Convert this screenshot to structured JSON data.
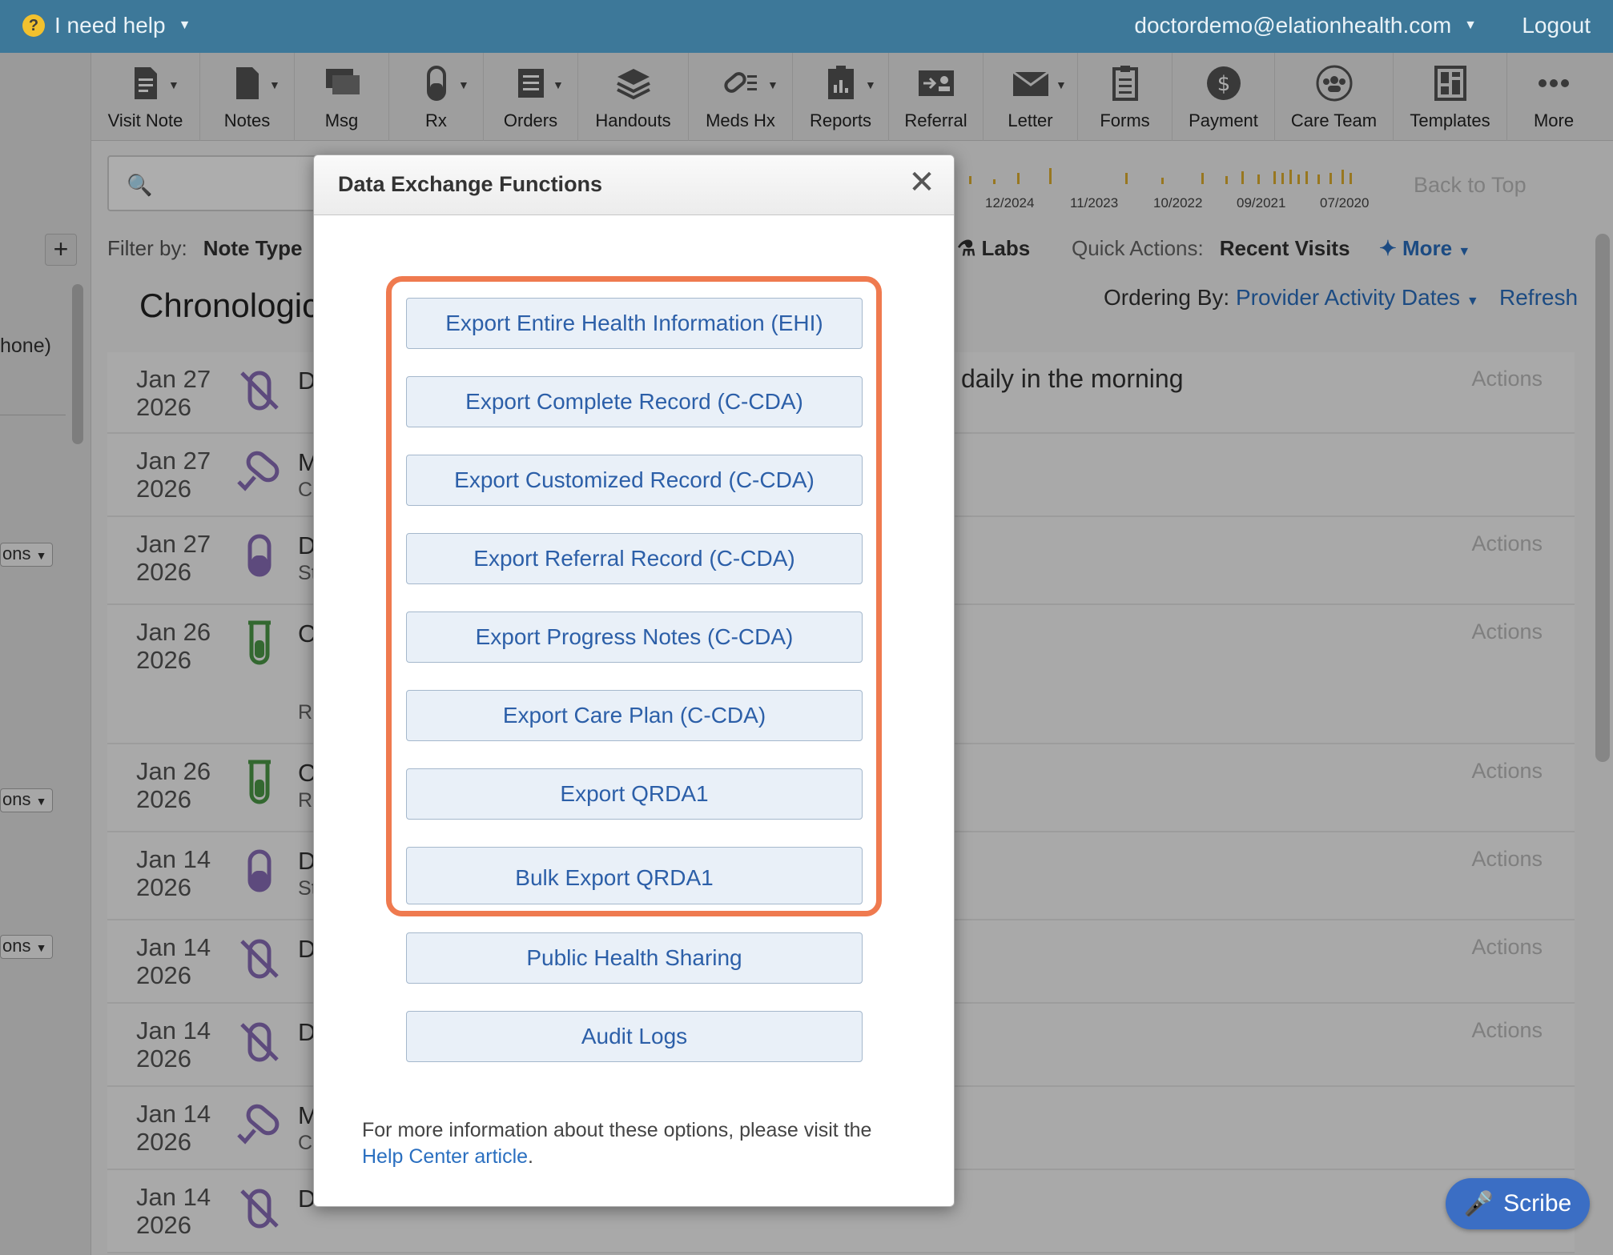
{
  "topbar": {
    "help_icon": "?",
    "help_label": "I need help",
    "user_email": "doctordemo@elationhealth.com",
    "logout": "Logout"
  },
  "toolbar": {
    "items": [
      {
        "label": "Visit Note",
        "icon": "document-icon",
        "dropdown": true
      },
      {
        "label": "Notes",
        "icon": "page-icon",
        "dropdown": true
      },
      {
        "label": "Msg",
        "icon": "chat-icon",
        "dropdown": false
      },
      {
        "label": "Rx",
        "icon": "pill-icon",
        "dropdown": true
      },
      {
        "label": "Orders",
        "icon": "list-icon",
        "dropdown": true
      },
      {
        "label": "Handouts",
        "icon": "layers-icon",
        "dropdown": false
      },
      {
        "label": "Meds Hx",
        "icon": "meds-history-icon",
        "dropdown": true
      },
      {
        "label": "Reports",
        "icon": "clipboard-chart-icon",
        "dropdown": true
      },
      {
        "label": "Referral",
        "icon": "referral-icon",
        "dropdown": false
      },
      {
        "label": "Letter",
        "icon": "envelope-icon",
        "dropdown": true
      },
      {
        "label": "Forms",
        "icon": "form-icon",
        "dropdown": false
      },
      {
        "label": "Payment",
        "icon": "dollar-icon",
        "dropdown": false
      },
      {
        "label": "Care Team",
        "icon": "team-icon",
        "dropdown": false
      },
      {
        "label": "Templates",
        "icon": "template-icon",
        "dropdown": false
      },
      {
        "label": "More",
        "icon": "ellipsis-icon",
        "dropdown": false
      }
    ]
  },
  "timeline": {
    "dates": [
      "12/2024",
      "11/2023",
      "10/2022",
      "09/2021",
      "07/2020"
    ],
    "back_to_top": "Back to Top"
  },
  "filters": {
    "filter_by": "Filter by:",
    "note_type": "Note Type",
    "labs": "Labs",
    "quick_actions": "Quick Actions:",
    "recent_visits": "Recent Visits",
    "more": "More"
  },
  "chronology": {
    "title": "Chronologic",
    "ordering_label": "Ordering By:",
    "ordering_value": "Provider Activity Dates",
    "refresh": "Refresh"
  },
  "left_panel": {
    "fragment_none": "hone)",
    "select_label": "ons"
  },
  "rows": [
    {
      "month": "Jan 27",
      "year": "2026",
      "letter": "D",
      "sub": "",
      "icon": "discontinued-pill-icon",
      "actions": "Actions"
    },
    {
      "month": "Jan 27",
      "year": "2026",
      "letter": "M",
      "sub": "C",
      "icon": "medication-check-icon",
      "actions": ""
    },
    {
      "month": "Jan 27",
      "year": "2026",
      "letter": "D",
      "sub": "St",
      "icon": "pill-capsule-icon",
      "actions": "Actions"
    },
    {
      "month": "Jan 26",
      "year": "2026",
      "letter": "C",
      "sub": "R",
      "icon": "lab-tube-icon",
      "actions": "Actions"
    },
    {
      "month": "Jan 26",
      "year": "2026",
      "letter": "C",
      "sub": "R",
      "icon": "lab-tube-icon",
      "actions": "Actions"
    },
    {
      "month": "Jan 14",
      "year": "2026",
      "letter": "D",
      "sub": "St",
      "icon": "pill-capsule-icon",
      "actions": "Actions"
    },
    {
      "month": "Jan 14",
      "year": "2026",
      "letter": "D",
      "sub": "",
      "icon": "discontinued-pill-icon",
      "actions": "Actions"
    },
    {
      "month": "Jan 14",
      "year": "2026",
      "letter": "D",
      "sub": "",
      "icon": "discontinued-pill-icon",
      "actions": "Actions"
    },
    {
      "month": "Jan 14",
      "year": "2026",
      "letter": "M",
      "sub": "C",
      "icon": "medication-check-icon",
      "actions": ""
    },
    {
      "month": "Jan 14",
      "year": "2026",
      "letter": "D",
      "sub": "",
      "icon": "discontinued-pill-icon",
      "actions": ""
    }
  ],
  "row_text": "daily in the morning",
  "scribe": "Scribe",
  "modal": {
    "title": "Data Exchange Functions",
    "close": "✕",
    "buttons": [
      "Export Entire Health Information (EHI)",
      "Export Complete Record (C-CDA)",
      "Export Customized Record (C-CDA)",
      "Export Referral Record (C-CDA)",
      "Export Progress Notes (C-CDA)",
      "Export Care Plan (C-CDA)",
      "Export QRDA1",
      "Bulk Export QRDA1",
      "Public Health Sharing",
      "Audit Logs"
    ],
    "info_text": "For more information about these options, please visit the",
    "info_link": "Help Center article",
    "info_end": "."
  },
  "colors": {
    "topbar": "#3d7899",
    "highlight": "#ef7a4f",
    "link": "#2a6fc0",
    "button_text": "#2c5fa8"
  }
}
